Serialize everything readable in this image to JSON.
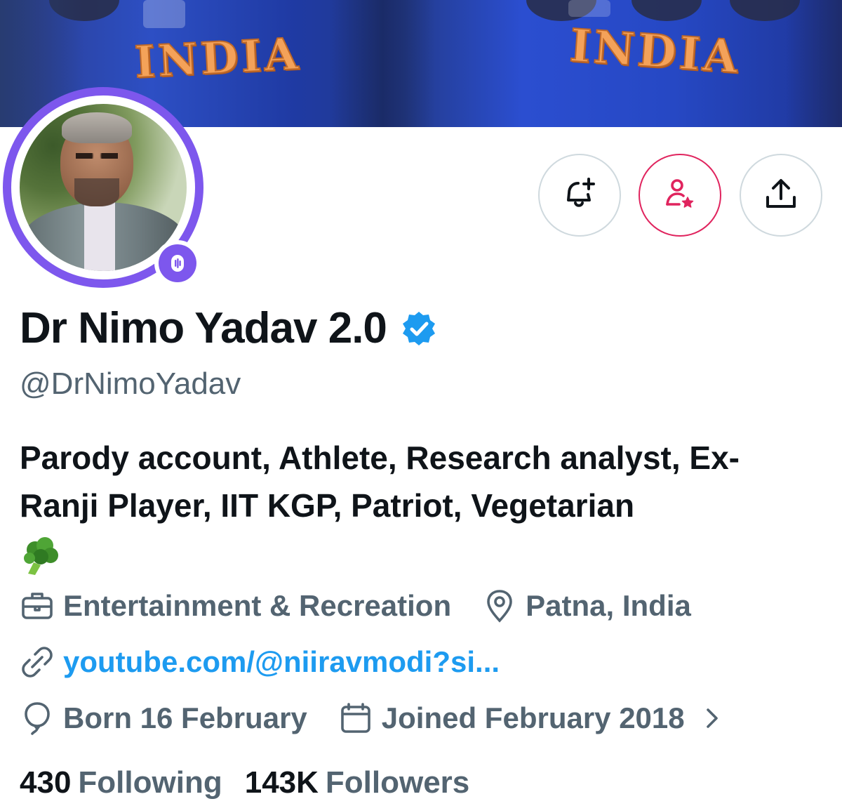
{
  "banner": {
    "jersey_text_left": "INDIA",
    "jersey_text_right": "INDIA"
  },
  "profile": {
    "display_name": "Dr Nimo Yadav 2.0",
    "handle": "@DrNimoYadav",
    "verified_icon": "verified-badge-icon",
    "bio": "Parody account, Athlete, Research analyst, Ex- Ranji Player, IIT KGP, Patriot, Vegetarian",
    "bio_emoji": "broccoli-emoji",
    "category": "Entertainment & Recreation",
    "location": "Patna, India",
    "website": "youtube.com/@niiravmodi?si...",
    "birthday": "Born 16 February",
    "joined": "Joined February 2018"
  },
  "stats": {
    "following_count": "430",
    "following_label": "Following",
    "followers_count": "143K",
    "followers_label": "Followers"
  },
  "actions": {
    "notify_icon": "bell-plus-icon",
    "follow_icon": "person-star-icon",
    "share_icon": "share-upload-icon"
  },
  "colors": {
    "accent_blue": "#1d9bf0",
    "spaces_purple": "#7d57ed",
    "follow_pink": "#e0245e",
    "secondary_text": "#536471",
    "primary_text": "#0f1419"
  }
}
